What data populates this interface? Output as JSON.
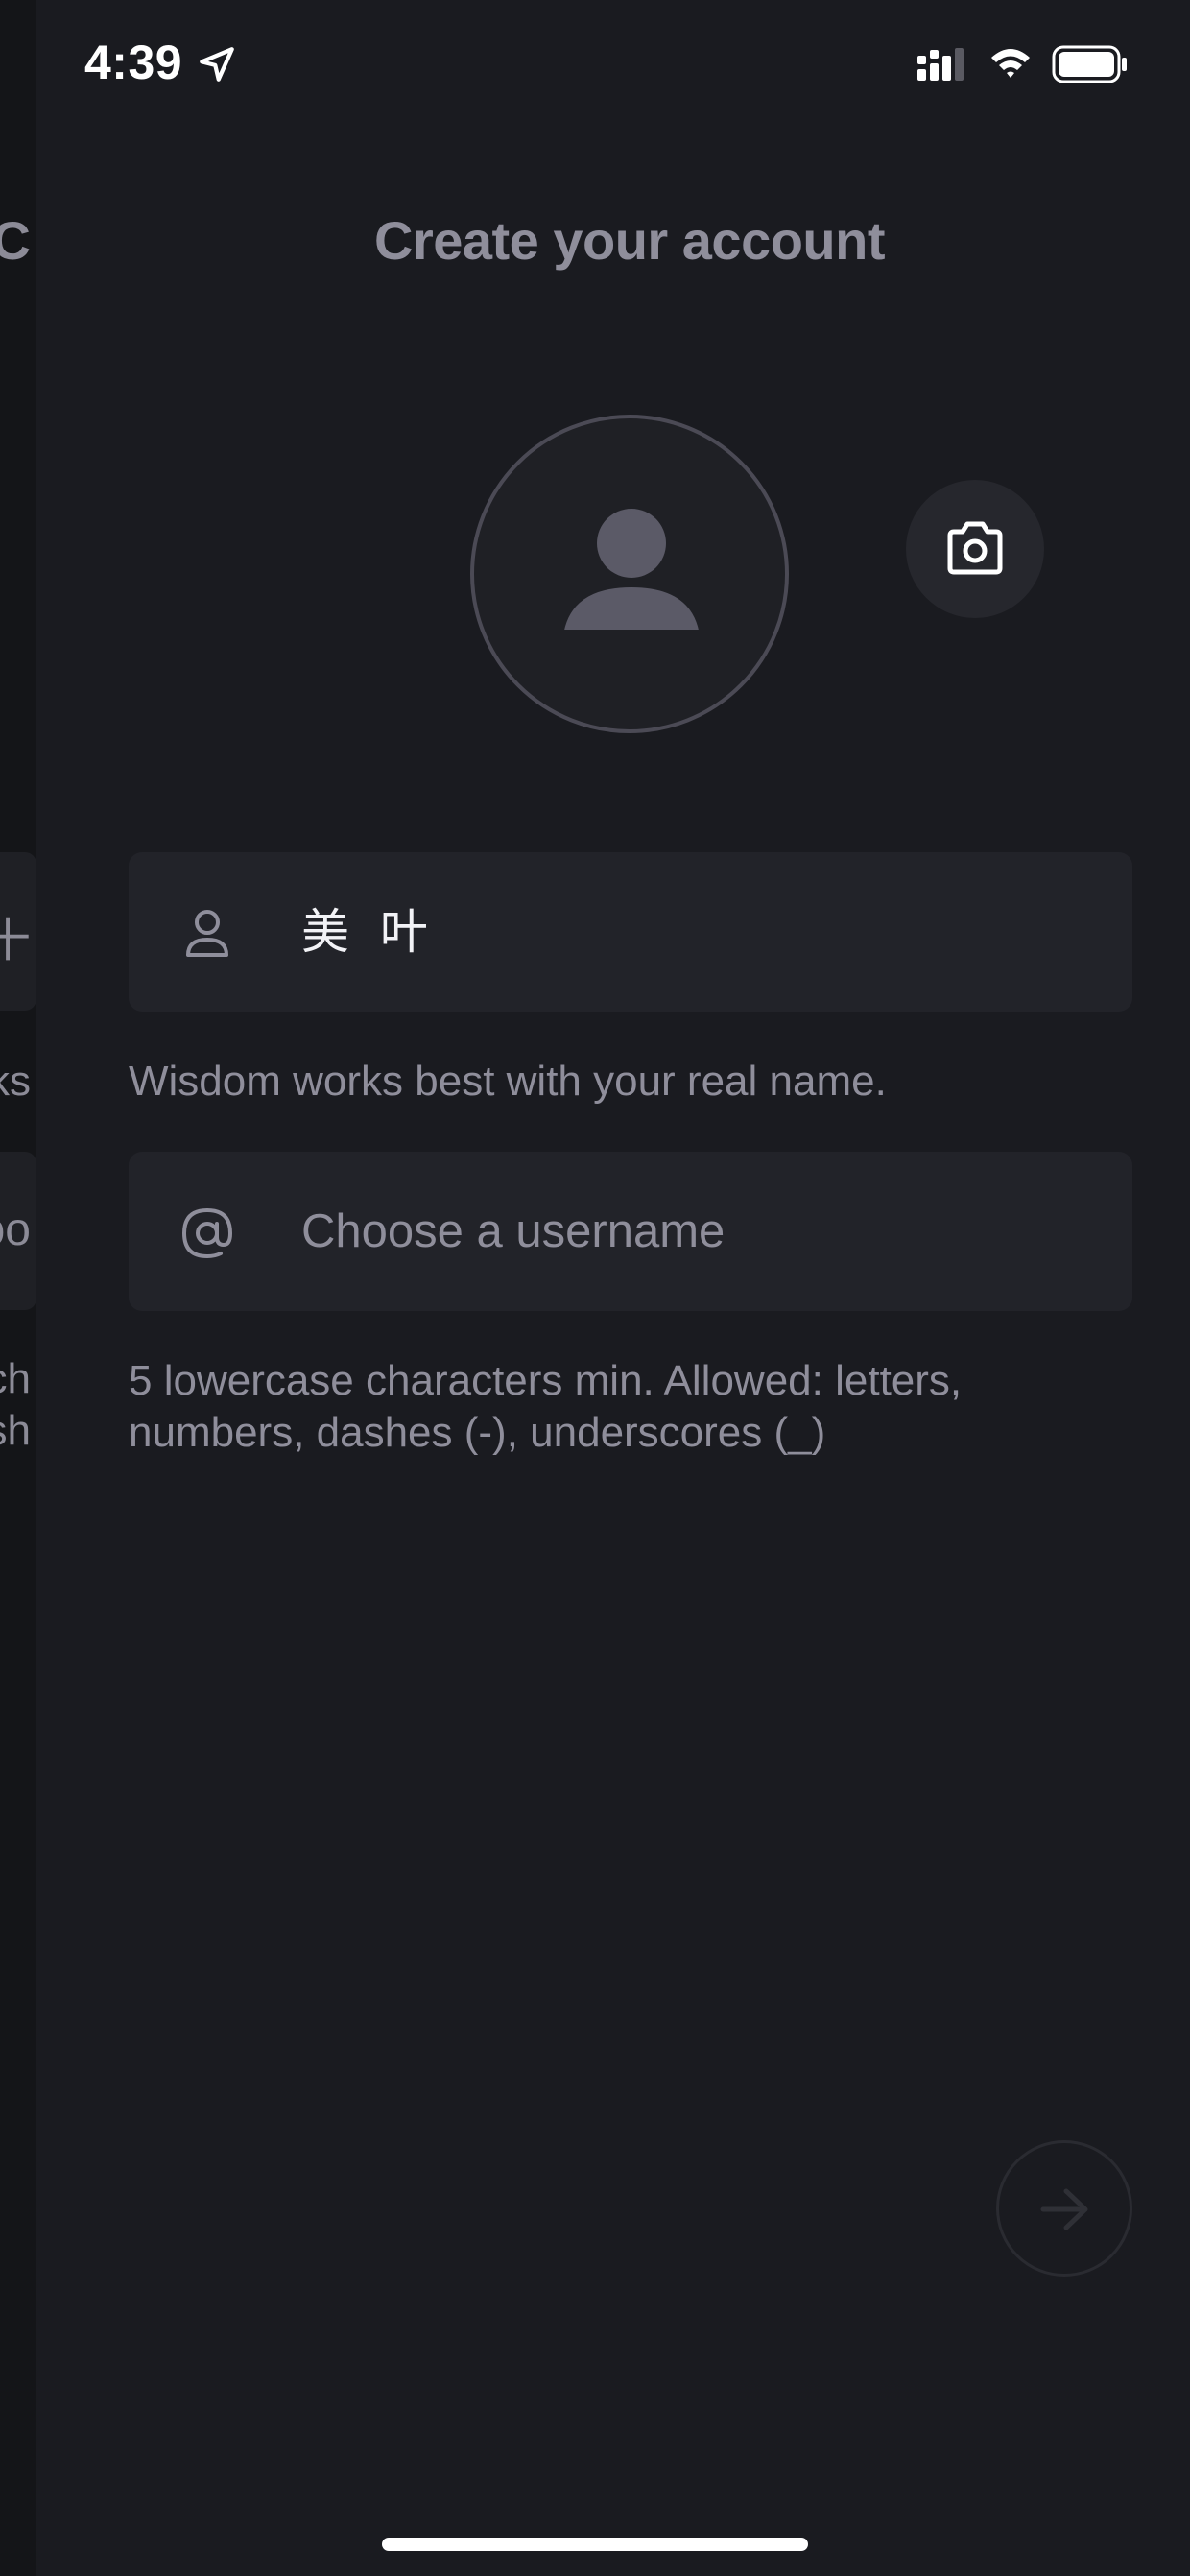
{
  "status_bar": {
    "time": "4:39"
  },
  "previous_screen": {
    "title_fragment": "C",
    "field1_fragment": "十",
    "help1_fragment": "ks",
    "field2_fragment": "oo",
    "help2_line1_fragment": "ch",
    "help2_line2_fragment": "sh"
  },
  "page": {
    "title": "Create your account"
  },
  "name_field": {
    "icon": "person-icon",
    "value": "美 叶",
    "help": "Wisdom works best with your real name."
  },
  "username_field": {
    "icon": "at-sign-icon",
    "value": "",
    "placeholder": "Choose a username",
    "help": "5 lowercase characters min. Allowed: letters, numbers, dashes (-), underscores (_)"
  },
  "colors": {
    "background": "#1a1b20",
    "field_background": "#222329",
    "muted_text": "#8f8e9b",
    "avatar_border": "#4b4a55"
  }
}
